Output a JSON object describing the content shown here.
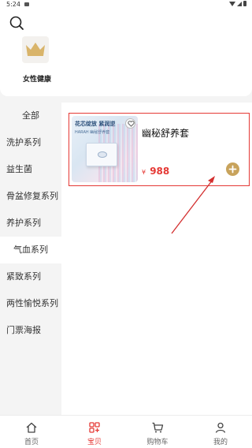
{
  "status_bar": {
    "time": "5:24"
  },
  "category_tiles": [
    {
      "label": "女性健康",
      "icon": "crown-icon"
    }
  ],
  "sidebar": {
    "items": [
      {
        "label": "全部"
      },
      {
        "label": "洗护系列"
      },
      {
        "label": "益生菌"
      },
      {
        "label": "骨盆修复系列"
      },
      {
        "label": "养护系列"
      },
      {
        "label": "气血系列"
      },
      {
        "label": "紧致系列"
      },
      {
        "label": "两性愉悦系列"
      },
      {
        "label": "门票海报"
      }
    ],
    "active_index": 5
  },
  "products": [
    {
      "name": "幽秘舒养套",
      "currency": "¥",
      "price": "988",
      "image_text": "花芯绽放 紧润逆",
      "image_subtext": "HARAH 幽秘舒养套",
      "favorite_icon": "heart-icon",
      "add_icon": "plus-icon"
    }
  ],
  "tabbar": {
    "tabs": [
      {
        "label": "首页",
        "icon": "home-icon"
      },
      {
        "label": "宝贝",
        "icon": "grid-icon"
      },
      {
        "label": "购物车",
        "icon": "cart-icon"
      },
      {
        "label": "我的",
        "icon": "user-icon"
      }
    ],
    "active_index": 1
  },
  "colors": {
    "accent": "#e53935",
    "gold": "#c8a35c",
    "sidebar_bg": "#f4f4f4"
  }
}
